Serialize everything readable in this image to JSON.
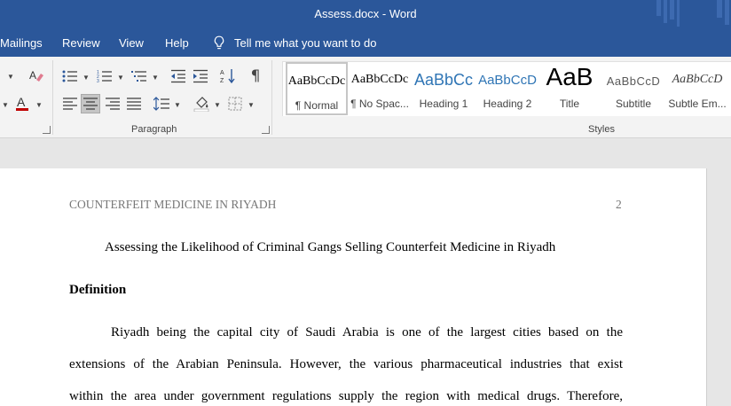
{
  "window": {
    "title": "Assess.docx  -  Word"
  },
  "menu": {
    "tabs": [
      "Mailings",
      "Review",
      "View",
      "Help"
    ],
    "tell_me": "Tell me what you want to do"
  },
  "ribbon": {
    "paragraph_label": "Paragraph",
    "styles_label": "Styles",
    "styles": [
      {
        "sample": "AaBbCcDc",
        "name": "¶ Normal"
      },
      {
        "sample": "AaBbCcDc",
        "name": "¶ No Spac..."
      },
      {
        "sample": "AaBbCc",
        "name": "Heading 1"
      },
      {
        "sample": "AaBbCcD",
        "name": "Heading 2"
      },
      {
        "sample": "AaB",
        "name": "Title"
      },
      {
        "sample": "AaBbCcD",
        "name": "Subtitle"
      },
      {
        "sample": "AaBbCcD",
        "name": "Subtle Em..."
      }
    ]
  },
  "document": {
    "running_head": "COUNTERFEIT MEDICINE IN RIYADH",
    "page_number": "2",
    "title": "Assessing the Likelihood of Criminal Gangs Selling Counterfeit Medicine in Riyadh",
    "heading": "Definition",
    "lines": [
      "Riyadh being the capital city of Saudi Arabia is one of the largest cities based on the",
      "extensions of the Arabian Peninsula. However, the various pharmaceutical industries that exist",
      "within the area under government regulations supply the region with medical drugs. Therefore,"
    ]
  },
  "colors": {
    "word_blue": "#2b579a",
    "ribbon_bg": "#f3f3f3",
    "canvas_bg": "#e6e6e6"
  }
}
